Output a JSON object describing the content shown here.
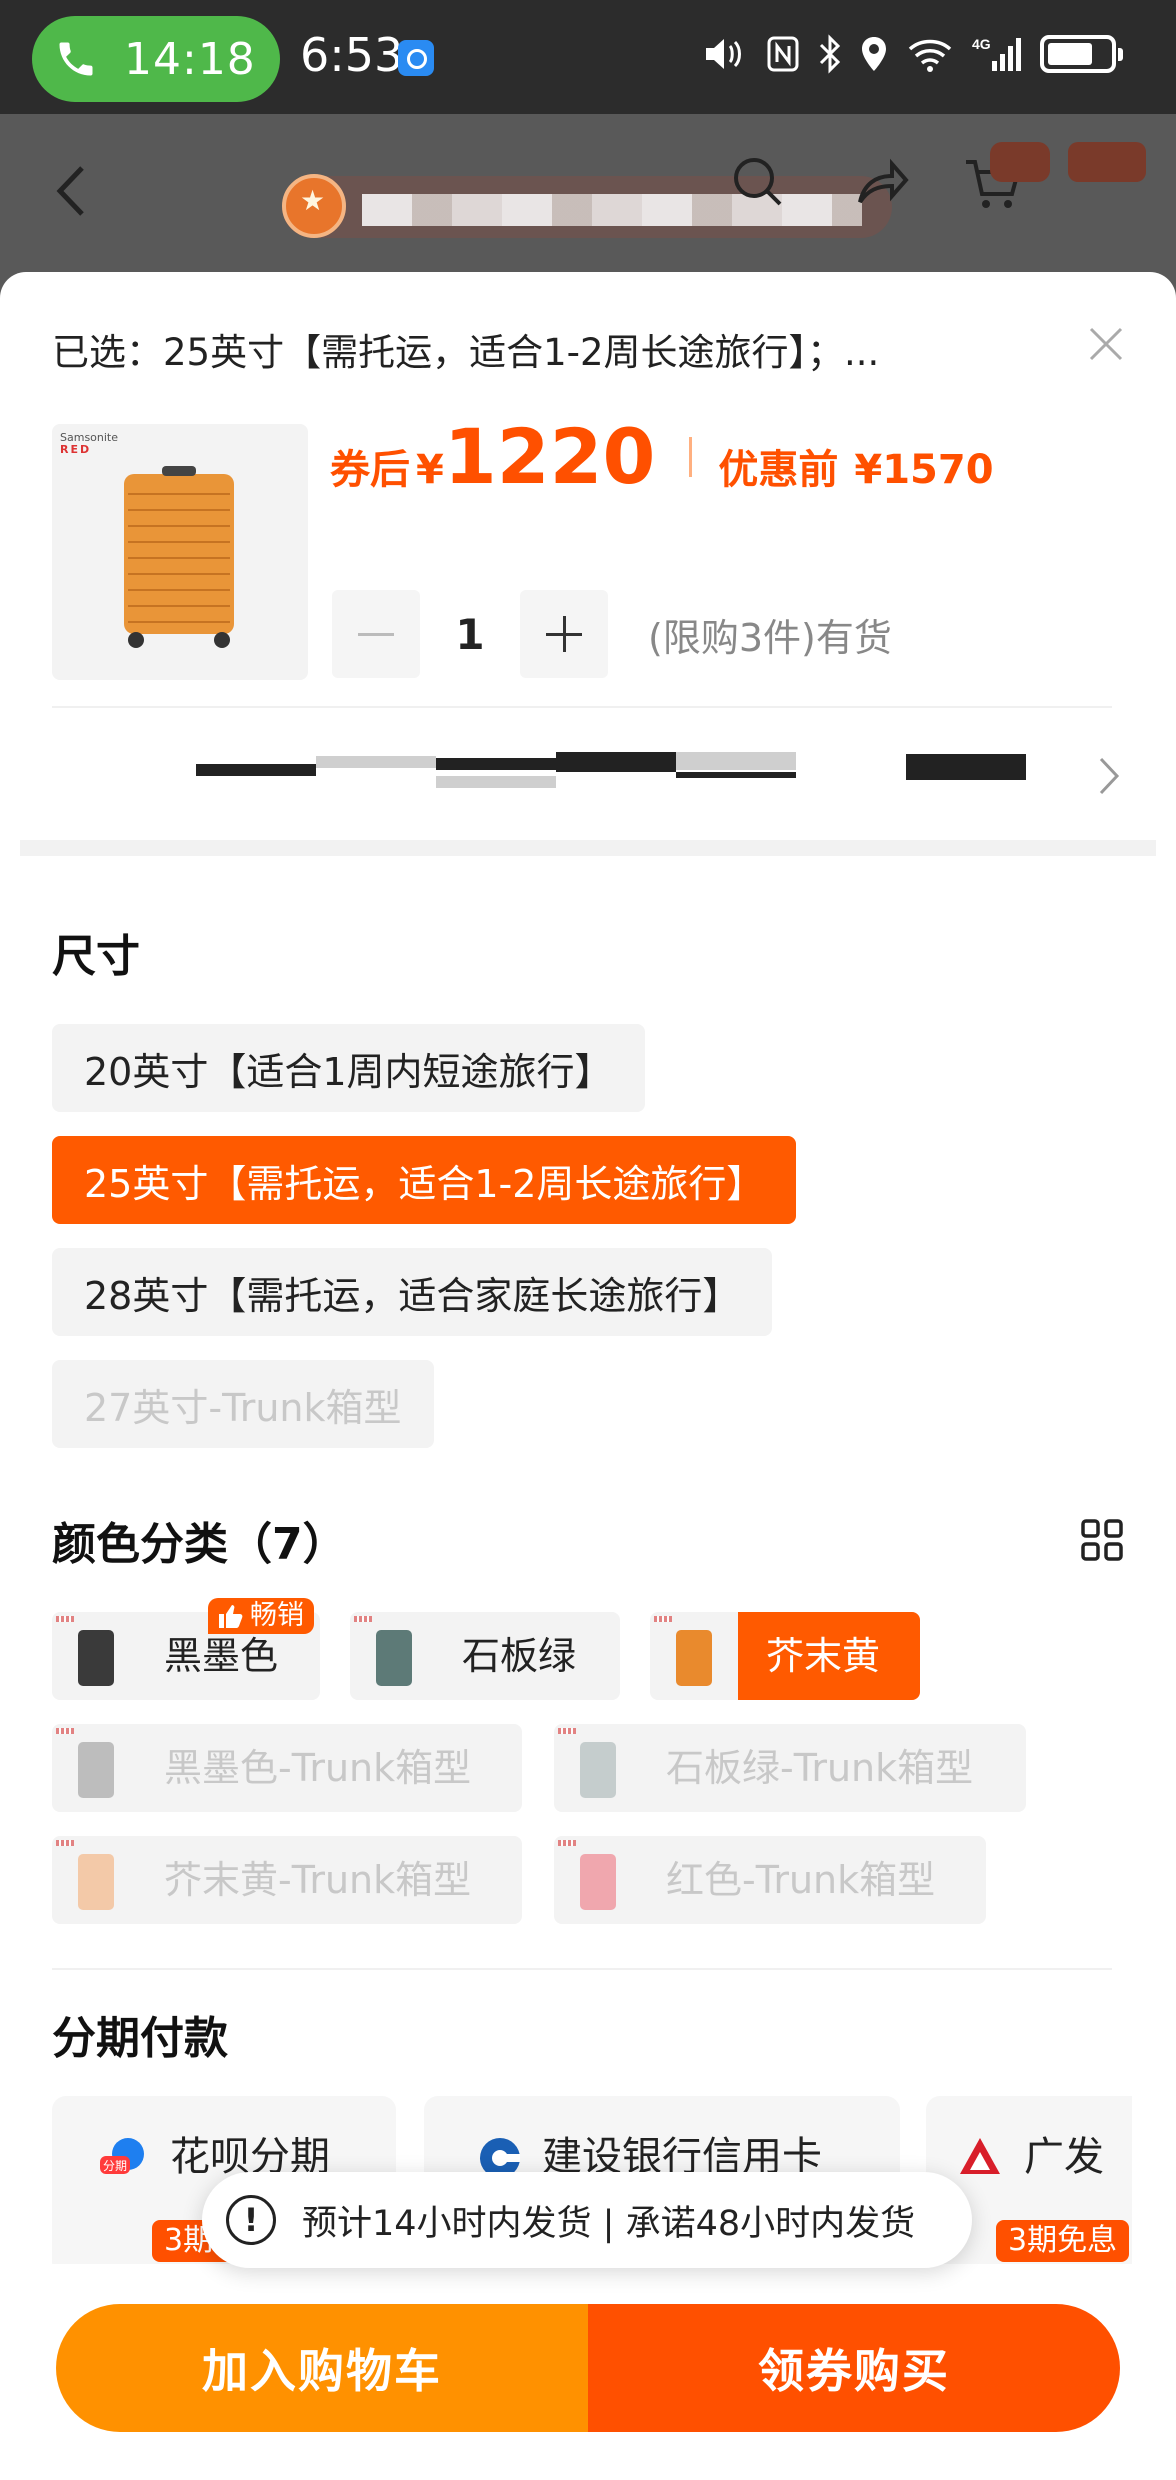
{
  "status_bar": {
    "call_time": "14:18",
    "clock": "6:53"
  },
  "header": {
    "back_icon": "chevron-left-icon",
    "search_icon": "search-icon",
    "share_icon": "share-icon",
    "cart_icon": "cart-icon"
  },
  "sheet": {
    "selected_text": "已选：25英寸【需托运，适合1-2周长途旅行】；...",
    "price": {
      "after_coupon_label": "券后",
      "currency": "¥",
      "after_coupon_value": "1220",
      "before_discount_label": "优惠前",
      "before_discount_value": "¥1570"
    },
    "product_image_brand": "Samsonite",
    "product_image_brand_sub": "RED",
    "quantity": "1",
    "limit_text": "(限购3件)有货"
  },
  "size": {
    "title": "尺寸",
    "options": [
      {
        "label": "20英寸【适合1周内短途旅行】",
        "state": "normal"
      },
      {
        "label": "25英寸【需托运，适合1-2周长途旅行】",
        "state": "selected"
      },
      {
        "label": "28英寸【需托运，适合家庭长途旅行】",
        "state": "normal"
      },
      {
        "label": "27英寸-Trunk箱型",
        "state": "disabled"
      }
    ]
  },
  "color": {
    "title": "颜色分类（7）",
    "hot_badge": "畅销",
    "options": [
      {
        "label": "黑墨色",
        "state": "normal",
        "swatch": "#3a3a3a"
      },
      {
        "label": "石板绿",
        "state": "normal",
        "swatch": "#5d7a77"
      },
      {
        "label": "芥末黄",
        "state": "selected",
        "swatch": "#e98a2d"
      },
      {
        "label": "黑墨色-Trunk箱型",
        "state": "disabled",
        "swatch": "#bdbdbd"
      },
      {
        "label": "石板绿-Trunk箱型",
        "state": "disabled",
        "swatch": "#c5cdcd"
      },
      {
        "label": "芥末黄-Trunk箱型",
        "state": "disabled",
        "swatch": "#f3c9a8"
      },
      {
        "label": "红色-Trunk箱型",
        "state": "disabled",
        "swatch": "#f0a7ae"
      }
    ]
  },
  "installment": {
    "title": "分期付款",
    "options": [
      {
        "name": "花呗分期",
        "tag": "3期免息",
        "icon": "huabei-icon"
      },
      {
        "name": "建设银行信用卡",
        "tag": "",
        "icon": "ccb-icon"
      },
      {
        "name": "广发",
        "tag": "3期免息",
        "icon": "cgb-icon"
      }
    ]
  },
  "toast": {
    "text": "预计14小时内发货 | 承诺48小时内发货"
  },
  "actions": {
    "add_to_cart": "加入购物车",
    "buy_now": "领券购买"
  }
}
